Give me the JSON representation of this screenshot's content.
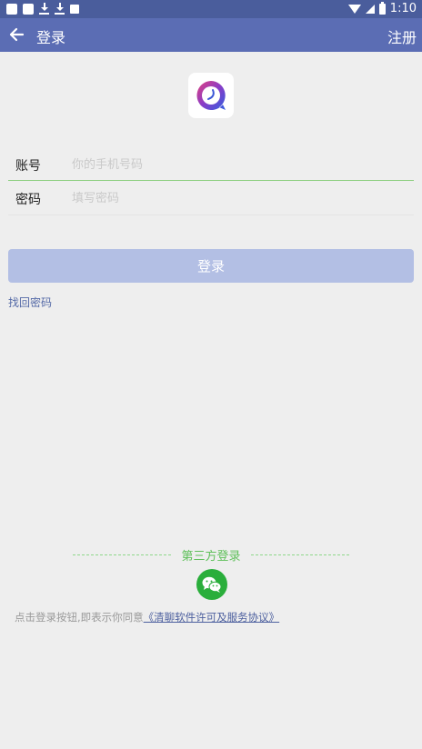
{
  "status_bar": {
    "time": "1:10",
    "icons": [
      "notification-icon",
      "notification-icon",
      "download-icon",
      "download-icon",
      "image-icon",
      "wifi-icon",
      "signal-icon",
      "battery-icon"
    ]
  },
  "app_bar": {
    "back_icon": "arrow-left-icon",
    "title": "登录",
    "register_label": "注册"
  },
  "logo_icon": "chat-app-logo",
  "form": {
    "account_label": "账号",
    "account_placeholder": "你的手机号码",
    "account_value": "",
    "password_label": "密码",
    "password_placeholder": "填写密码",
    "password_value": ""
  },
  "login_button": "登录",
  "forgot_password": "找回密码",
  "third_party": {
    "label": "第三方登录",
    "icon": "wechat-icon"
  },
  "agreement": {
    "prefix": "点击登录按钮,即表示你同意",
    "link": "《清聊软件许可及服务协议》"
  },
  "colors": {
    "status_bar": "#4a5d9c",
    "app_bar": "#5b6db4",
    "login_button": "#b3bfe4",
    "accent_green": "#5fc05a",
    "wechat_green": "#2aae3b",
    "link": "#4c5f9e"
  }
}
